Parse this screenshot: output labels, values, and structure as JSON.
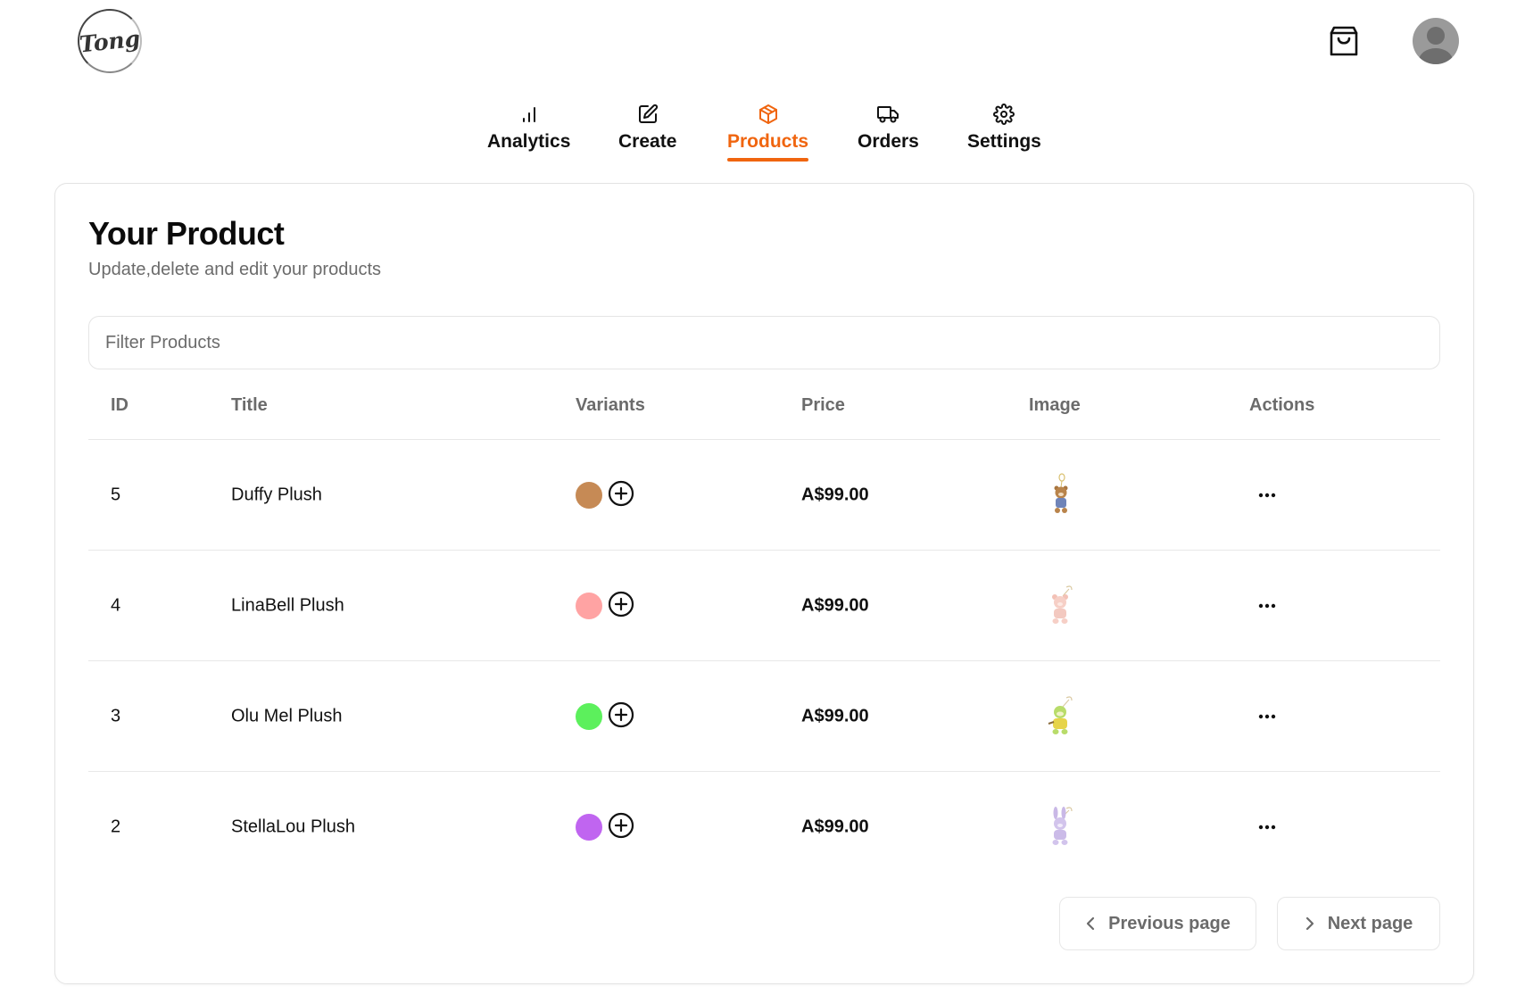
{
  "header": {
    "logo_text": "Tong",
    "cart_icon": "shopping-bag-icon",
    "avatar_icon": "user-avatar-icon"
  },
  "nav": {
    "tabs": [
      {
        "label": "Analytics",
        "icon": "bar-chart-icon",
        "active": false
      },
      {
        "label": "Create",
        "icon": "edit-icon",
        "active": false
      },
      {
        "label": "Products",
        "icon": "package-icon",
        "active": true
      },
      {
        "label": "Orders",
        "icon": "truck-icon",
        "active": false
      },
      {
        "label": "Settings",
        "icon": "gear-icon",
        "active": false
      }
    ],
    "active_color": "#f0650f"
  },
  "card": {
    "title": "Your Product",
    "subtitle": "Update,delete and edit your products"
  },
  "filter": {
    "placeholder": "Filter Products",
    "value": ""
  },
  "table": {
    "headers": {
      "id": "ID",
      "title": "Title",
      "variants": "Variants",
      "price": "Price",
      "image": "Image",
      "actions": "Actions"
    },
    "rows": [
      {
        "id": "5",
        "title": "Duffy Plush",
        "variant_color": "#c68a55",
        "price": "A$99.00",
        "image_icon": "duffy-plush-thumbnail"
      },
      {
        "id": "4",
        "title": "LinaBell Plush",
        "variant_color": "#ffa3a3",
        "price": "A$99.00",
        "image_icon": "linabell-plush-thumbnail"
      },
      {
        "id": "3",
        "title": "Olu Mel Plush",
        "variant_color": "#5cf05c",
        "price": "A$99.00",
        "image_icon": "olumel-plush-thumbnail"
      },
      {
        "id": "2",
        "title": "StellaLou Plush",
        "variant_color": "#c065f0",
        "price": "A$99.00",
        "image_icon": "stellalou-plush-thumbnail"
      }
    ]
  },
  "pagination": {
    "previous_label": "Previous page",
    "next_label": "Next page"
  }
}
